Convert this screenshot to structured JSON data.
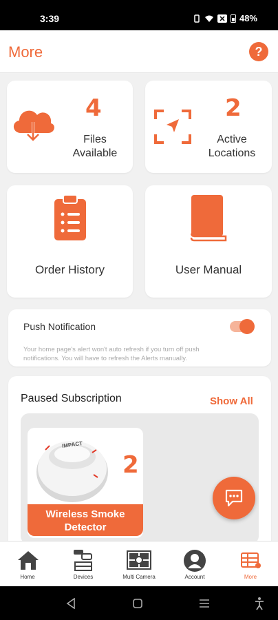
{
  "status_bar": {
    "time": "3:39",
    "battery": "48%"
  },
  "header": {
    "title": "More",
    "help_icon": "?"
  },
  "stats": {
    "files": {
      "count": "4",
      "label_line1": "Files",
      "label_line2": "Available",
      "icon": "cloud-download-icon"
    },
    "locations": {
      "count": "2",
      "label_line1": "Active",
      "label_line2": "Locations",
      "icon": "location-arrow-icon"
    }
  },
  "tiles": {
    "order_history": {
      "label": "Order History",
      "icon": "clipboard-list-icon"
    },
    "user_manual": {
      "label": "User Manual",
      "icon": "book-icon"
    }
  },
  "push_notification": {
    "title": "Push Notification",
    "enabled": true,
    "description_line1": "Your home page's alert won't auto refresh if you turn off push",
    "description_line2": "notifications. You will have to refresh the Alerts manually."
  },
  "subscription": {
    "title": "Paused Subscription",
    "show_all": "Show All",
    "device": {
      "count": "2",
      "label_line1": "Wireless Smoke",
      "label_line2": "Detector",
      "brand": "IMPACT"
    }
  },
  "bottom_nav": [
    {
      "label": "Home",
      "icon": "home-icon"
    },
    {
      "label": "Devices",
      "icon": "devices-icon"
    },
    {
      "label": "Multi Camera",
      "icon": "multi-camera-icon"
    },
    {
      "label": "Account",
      "icon": "account-icon"
    },
    {
      "label": "More",
      "icon": "more-grid-icon"
    }
  ],
  "colors": {
    "accent": "#ef6a3a",
    "background": "#f1f1f1",
    "card": "#ffffff"
  }
}
